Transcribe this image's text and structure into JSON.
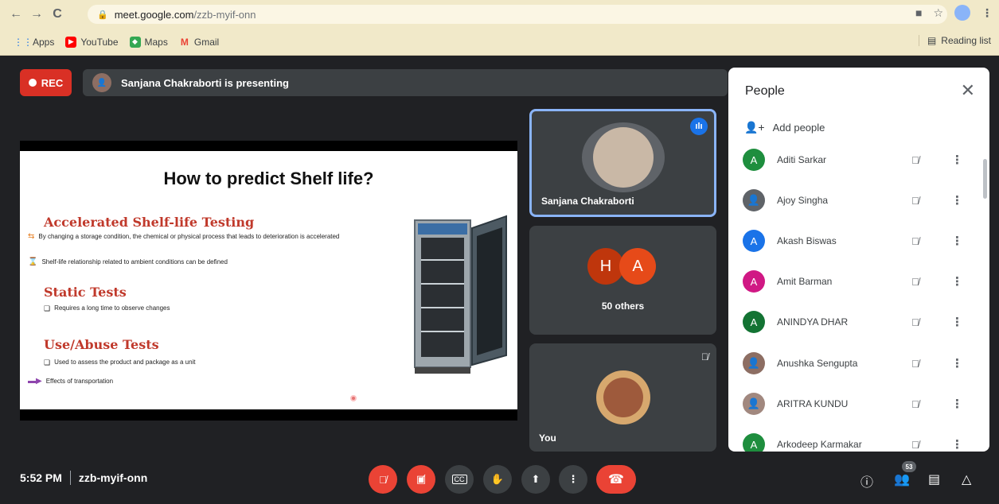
{
  "browser": {
    "url_host": "meet.google.com",
    "url_path": "/zzb-myif-onn",
    "bookmarks": [
      "Apps",
      "YouTube",
      "Maps",
      "Gmail"
    ],
    "reading_list": "Reading list"
  },
  "meet": {
    "rec_label": "REC",
    "presenting_text": "Sanjana Chakraborti is presenting",
    "time": "5:52 PM",
    "meeting_code": "zzb-myif-onn",
    "participant_count": "53"
  },
  "slide": {
    "title": "How to predict Shelf life?",
    "heading1": "Accelerated Shelf-life Testing",
    "bullet1": "By changing a storage condition, the chemical or physical process that leads to deterioration is accelerated",
    "bullet2": "Shelf-life relationship related to ambient conditions can be defined",
    "heading2": "Static Tests",
    "bullet3": "Requires a long time to observe changes",
    "heading3": "Use/Abuse Tests",
    "bullet4": "Used to assess the product and package as a unit",
    "bullet5": "Effects of transportation"
  },
  "tiles": {
    "presenter_name": "Sanjana Chakraborti",
    "others_label": "50 others",
    "others_letters": [
      "H",
      "A"
    ],
    "self_label": "You"
  },
  "people_panel": {
    "title": "People",
    "add_people": "Add people",
    "participants": [
      {
        "name": "Aditi Sarkar",
        "initial": "A",
        "color": "#1e8e3e"
      },
      {
        "name": "Ajoy Singha",
        "initial": "",
        "color": "#5f6368"
      },
      {
        "name": "Akash Biswas",
        "initial": "A",
        "color": "#1a73e8"
      },
      {
        "name": "Amit Barman",
        "initial": "A",
        "color": "#d01884"
      },
      {
        "name": "ANINDYA DHAR",
        "initial": "A",
        "color": "#137333"
      },
      {
        "name": "Anushka Sengupta",
        "initial": "",
        "color": "#8d6e63"
      },
      {
        "name": "ARITRA KUNDU",
        "initial": "",
        "color": "#a1887f"
      },
      {
        "name": "Arkodeep Karmakar",
        "initial": "A",
        "color": "#1e8e3e"
      }
    ]
  }
}
